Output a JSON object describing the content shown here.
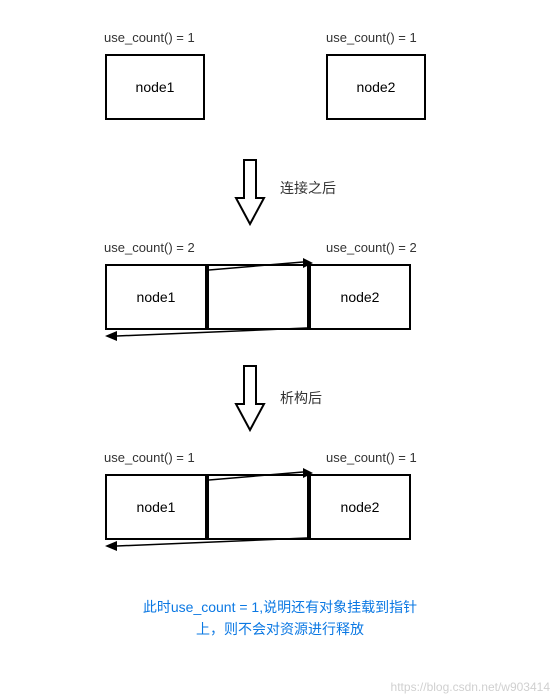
{
  "stages": [
    {
      "left_count": "use_count() = 1",
      "right_count": "use_count() = 1",
      "node1": "node1",
      "node2": "node2",
      "arrow_label": "连接之后",
      "connected": false
    },
    {
      "left_count": "use_count() = 2",
      "right_count": "use_count() = 2",
      "node1": "node1",
      "node2": "node2",
      "arrow_label": "析构后",
      "connected": true
    },
    {
      "left_count": "use_count() = 1",
      "right_count": "use_count() = 1",
      "node1": "node1",
      "node2": "node2",
      "arrow_label": "",
      "connected": true
    }
  ],
  "footnote_line1": "此时use_count = 1,说明还有对象挂载到指针",
  "footnote_line2": "上，则不会对资源进行释放",
  "watermark": "https://blog.csdn.net/w903414"
}
